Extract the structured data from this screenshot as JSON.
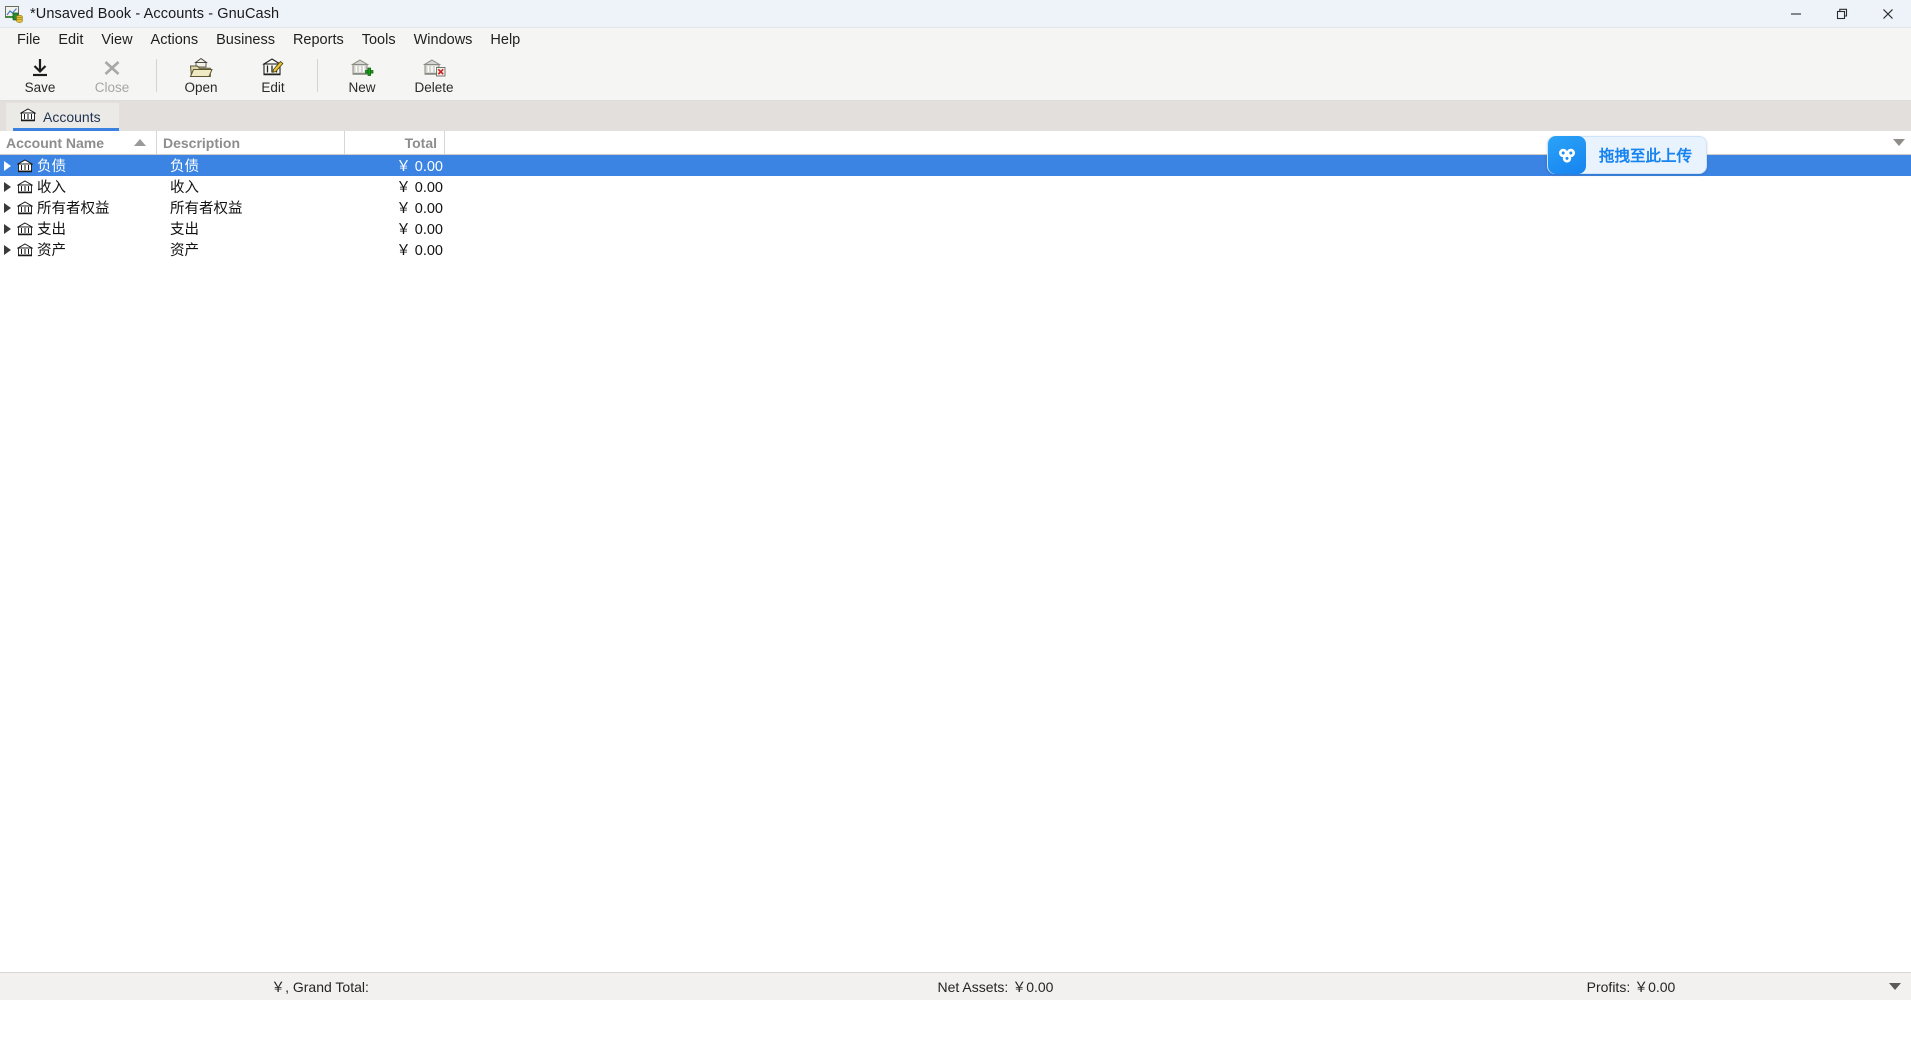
{
  "window": {
    "title": "*Unsaved Book - Accounts - GnuCash",
    "app_icon": "gnucash-icon",
    "controls": [
      {
        "name": "minimize-button",
        "glyph": "—"
      },
      {
        "name": "restore-button",
        "glyph": "❐"
      },
      {
        "name": "close-button",
        "glyph": "✕"
      }
    ]
  },
  "menubar": {
    "items": [
      {
        "label": "File"
      },
      {
        "label": "Edit"
      },
      {
        "label": "View"
      },
      {
        "label": "Actions"
      },
      {
        "label": "Business"
      },
      {
        "label": "Reports"
      },
      {
        "label": "Tools"
      },
      {
        "label": "Windows"
      },
      {
        "label": "Help"
      }
    ]
  },
  "toolbar": {
    "buttons": [
      {
        "label": "Save",
        "icon": "save-download-icon",
        "enabled": true
      },
      {
        "label": "Close",
        "icon": "close-x-icon",
        "enabled": false
      },
      {
        "label": "Open",
        "icon": "open-folder-icon",
        "enabled": true
      },
      {
        "label": "Edit",
        "icon": "edit-account-icon",
        "enabled": true
      },
      {
        "label": "New",
        "icon": "new-account-icon",
        "enabled": true
      },
      {
        "label": "Delete",
        "icon": "delete-account-icon",
        "enabled": true
      }
    ]
  },
  "tabs": [
    {
      "label": "Accounts",
      "icon": "bank-icon",
      "active": true
    }
  ],
  "table": {
    "columns": [
      {
        "label": "Account Name",
        "sort": "ascending"
      },
      {
        "label": "Description",
        "sort": "none"
      },
      {
        "label": "Total",
        "sort": "none"
      }
    ],
    "rows": [
      {
        "name": "负债",
        "description": "负债",
        "total": "￥ 0.00",
        "selected": true
      },
      {
        "name": "收入",
        "description": "收入",
        "total": "￥ 0.00",
        "selected": false
      },
      {
        "name": "所有者权益",
        "description": "所有者权益",
        "total": "￥ 0.00",
        "selected": false
      },
      {
        "name": "支出",
        "description": "支出",
        "total": "￥ 0.00",
        "selected": false
      },
      {
        "name": "资产",
        "description": "资产",
        "total": "￥ 0.00",
        "selected": false
      }
    ]
  },
  "upload_widget": {
    "label": "拖拽至此上传",
    "icon": "baidu-netdisk-cloud-icon",
    "accent": "#1683f0",
    "background": "#e9f3fd"
  },
  "statusbar": {
    "grand_total": "￥, Grand Total:",
    "net_assets": "Net Assets: ￥0.00",
    "profits": "Profits: ￥0.00"
  },
  "colors": {
    "selection_blue": "#3b84e3",
    "tab_underline": "#3b82e0",
    "titlebar_bg": "#eef3fa",
    "toolbar_bg": "#f5f5f3",
    "tabstrip_bg": "#e2dfdc",
    "statusbar_bg": "#f2f1ef",
    "header_text": "#8d8d8d"
  }
}
